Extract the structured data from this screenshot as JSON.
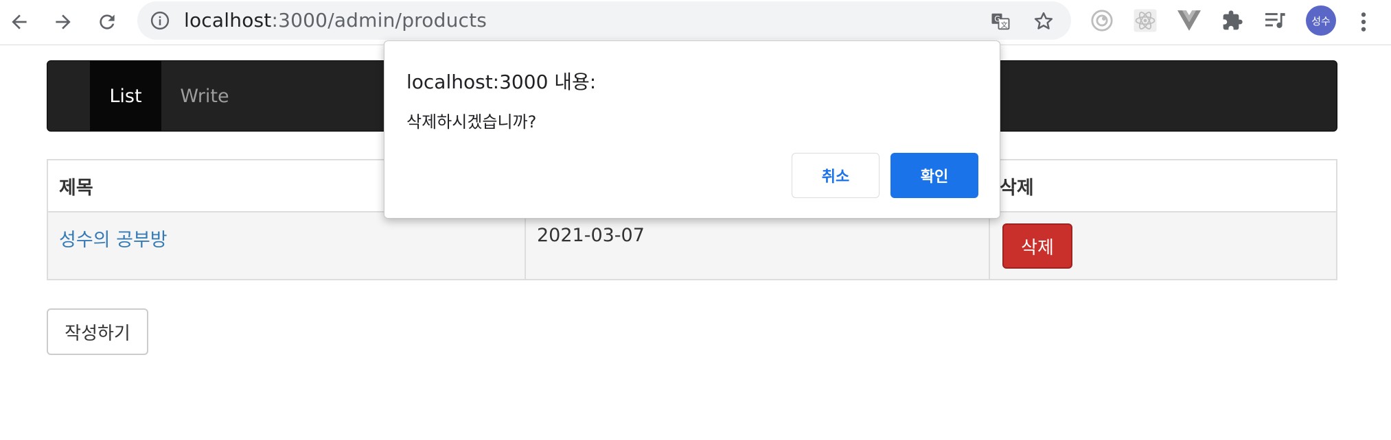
{
  "browser": {
    "url_host": "localhost",
    "url_path": ":3000/admin/products",
    "avatar_text": "성수",
    "icons": {
      "back": "back-arrow-icon",
      "forward": "forward-arrow-icon",
      "reload": "reload-icon",
      "info": "info-icon",
      "translate": "translate-icon",
      "bookmark": "star-icon",
      "extensions": [
        "target-extension-icon",
        "react-extension-icon",
        "vue-extension-icon",
        "puzzle-extension-icon",
        "media-queue-icon"
      ],
      "menu": "kebab-menu-icon"
    }
  },
  "navbar": {
    "items": [
      {
        "label": "List",
        "active": true
      },
      {
        "label": "Write",
        "active": false
      }
    ],
    "background": "#222222"
  },
  "table": {
    "headers": [
      "제목",
      "",
      "삭제"
    ],
    "rows": [
      {
        "title": "성수의 공부방",
        "date": "2021-03-07",
        "delete_label": "삭제"
      }
    ]
  },
  "write_button": "작성하기",
  "dialog": {
    "title": "localhost:3000 내용:",
    "message": "삭제하시겠습니까?",
    "cancel_label": "취소",
    "ok_label": "확인"
  },
  "colors": {
    "accent": "#1a73e8",
    "danger": "#c9302c",
    "link": "#337ab7"
  }
}
